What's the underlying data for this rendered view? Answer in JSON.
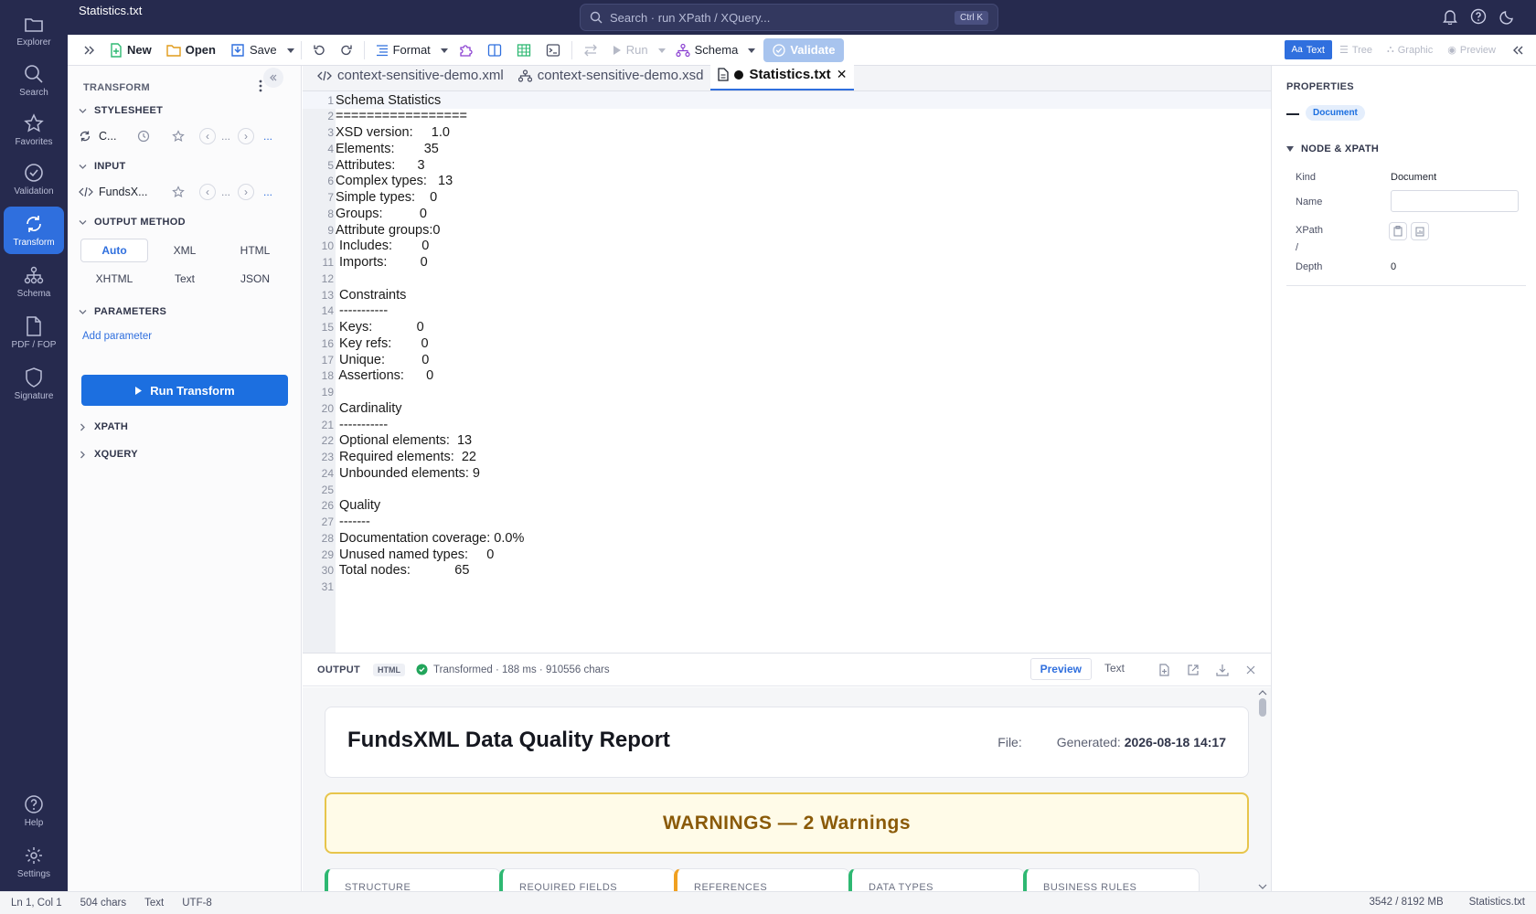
{
  "app": {
    "file_title": "Statistics.txt"
  },
  "nav": {
    "items": [
      {
        "label": "Explorer",
        "icon": "folder-icon"
      },
      {
        "label": "Search",
        "icon": "search-icon"
      },
      {
        "label": "Favorites",
        "icon": "star-icon"
      },
      {
        "label": "Validation",
        "icon": "check-circle-icon"
      },
      {
        "label": "Transform",
        "icon": "refresh-icon",
        "active": true
      },
      {
        "label": "Schema",
        "icon": "hierarchy-icon"
      },
      {
        "label": "PDF / FOP",
        "icon": "pdf-icon"
      },
      {
        "label": "Signature",
        "icon": "shield-icon"
      }
    ],
    "bottom": [
      {
        "label": "Help",
        "icon": "help-icon"
      },
      {
        "label": "Settings",
        "icon": "gear-icon"
      }
    ]
  },
  "search": {
    "placeholder": "Search · run XPath / XQuery...",
    "shortcut": "Ctrl K"
  },
  "toolbar": {
    "new": "New",
    "open": "Open",
    "save": "Save",
    "format": "Format",
    "run": "Run",
    "schema": "Schema",
    "validate": "Validate",
    "views": [
      "Text",
      "Tree",
      "Graphic",
      "Preview"
    ]
  },
  "transform": {
    "title": "TRANSFORM",
    "stylesheet_label": "STYLESHEET",
    "stylesheet_value": "C...",
    "input_label": "INPUT",
    "input_value": "FundsX...",
    "ellipsis": "...",
    "output_method_label": "OUTPUT METHOD",
    "output_methods": [
      "Auto",
      "XML",
      "HTML",
      "XHTML",
      "Text",
      "JSON"
    ],
    "selected_method": "Auto",
    "parameters_label": "PARAMETERS",
    "add_parameter": "Add parameter",
    "run_button": "Run Transform",
    "xpath_label": "XPATH",
    "xquery_label": "XQUERY"
  },
  "tabs": [
    {
      "label": "context-sensitive-demo.xml",
      "icon": "code-icon"
    },
    {
      "label": "context-sensitive-demo.xsd",
      "icon": "hierarchy-icon"
    },
    {
      "label": "Statistics.txt",
      "icon": "file-icon",
      "active": true,
      "modified": true
    }
  ],
  "editor": {
    "lines": [
      "Schema Statistics",
      "=================",
      "XSD version:     1.0",
      "Elements:        35",
      "Attributes:      3",
      "Complex types:   13",
      "Simple types:    0",
      "Groups:          0",
      "Attribute groups:0",
      " Includes:        0",
      " Imports:         0",
      "",
      " Constraints",
      " -----------",
      " Keys:            0",
      " Key refs:        0",
      " Unique:          0",
      " Assertions:      0",
      "",
      " Cardinality",
      " -----------",
      " Optional elements:  13",
      " Required elements:  22",
      " Unbounded elements: 9",
      "",
      " Quality",
      " -------",
      " Documentation coverage: 0.0%",
      " Unused named types:     0",
      " Total nodes:            65",
      ""
    ]
  },
  "output": {
    "title": "OUTPUT",
    "badge": "HTML",
    "status": "Transformed · 188 ms · 910556 chars",
    "tabs": [
      "Preview",
      "Text"
    ],
    "report_title": "FundsXML Data Quality Report",
    "file_label": "File:",
    "generated_label": "Generated:",
    "generated_value": "2026-08-18 14:17",
    "warnings_banner": "WARNINGS — 2 Warnings",
    "cards": [
      {
        "label": "STRUCTURE",
        "color": "#2eb872"
      },
      {
        "label": "REQUIRED FIELDS",
        "color": "#2eb872"
      },
      {
        "label": "REFERENCES",
        "color": "#f0a020"
      },
      {
        "label": "DATA TYPES",
        "color": "#2eb872"
      },
      {
        "label": "BUSINESS RULES",
        "color": "#2eb872"
      }
    ]
  },
  "properties": {
    "title": "PROPERTIES",
    "doc_badge": "Document",
    "node_xpath_label": "NODE & XPATH",
    "kind_label": "Kind",
    "kind_value": "Document",
    "name_label": "Name",
    "xpath_label": "XPath",
    "xpath_value": "/",
    "depth_label": "Depth",
    "depth_value": "0"
  },
  "statusbar": {
    "position": "Ln 1, Col 1",
    "chars": "504 chars",
    "mode": "Text",
    "encoding": "UTF-8",
    "memory": "3542 / 8192 MB",
    "file": "Statistics.txt"
  },
  "colors": {
    "nav_bg": "#262a4e",
    "accent": "#2f6fde",
    "warning": "#e7c54b",
    "ok": "#2eb872"
  }
}
